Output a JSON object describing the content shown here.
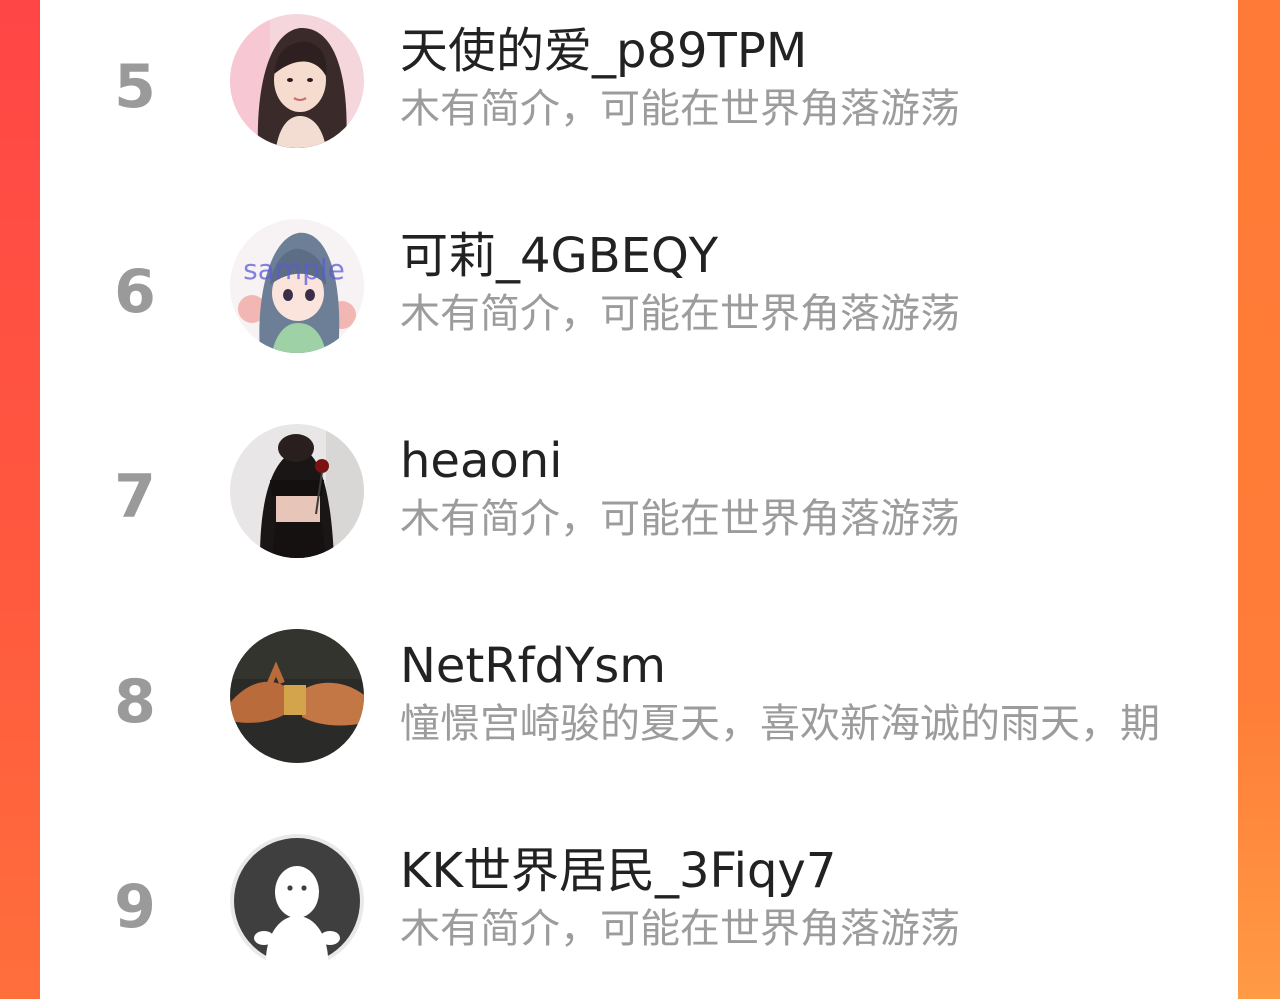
{
  "theme": {
    "panel_bg": "#ffffff",
    "accent_left": "#ff4646",
    "accent_right": "#ff7a36",
    "rank_color": "#9a9a9a",
    "name_color": "#222222",
    "bio_color": "#9c9c9c"
  },
  "ranking": {
    "entries": [
      {
        "rank": "5",
        "name": "天使的爱_p89TPM",
        "bio": "木有简介，可能在世界角落游荡",
        "avatar_icon": "avatar-girl-photo"
      },
      {
        "rank": "6",
        "name": "可莉_4GBEQY",
        "bio": "木有简介，可能在世界角落游荡",
        "avatar_icon": "avatar-anime-illustration",
        "avatar_watermark": "sample"
      },
      {
        "rank": "7",
        "name": "heaoni",
        "bio": "木有简介，可能在世界角落游荡",
        "avatar_icon": "avatar-dark-photo"
      },
      {
        "rank": "8",
        "name": "NetRfdYsm",
        "bio": "憧憬宫崎骏的夏天，喜欢新海诚的雨天，期",
        "avatar_icon": "avatar-hands-photo"
      },
      {
        "rank": "9",
        "name": "KK世界居民_3Fiqy7",
        "bio": "木有简介，可能在世界角落游荡",
        "avatar_icon": "default-avatar-icon"
      }
    ]
  }
}
